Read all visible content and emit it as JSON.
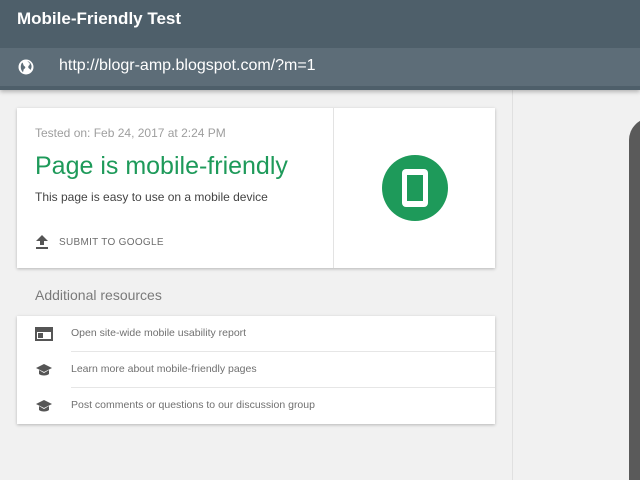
{
  "header": {
    "title": "Mobile-Friendly Test",
    "url": "http://blogr-amp.blogspot.com/?m=1",
    "globe_icon": "globe-icon"
  },
  "result": {
    "tested_on": "Tested on: Feb 24, 2017 at 2:24 PM",
    "verdict": "Page is mobile-friendly",
    "description": "This page is easy to use on a mobile device",
    "submit_label": "SUBMIT TO GOOGLE",
    "submit_icon": "upload-icon",
    "badge_icon": "phone-icon",
    "accent_color": "#1e9a5a"
  },
  "resources": {
    "title": "Additional resources",
    "items": [
      {
        "label": "Open site-wide mobile usability report",
        "icon": "browser-window-icon"
      },
      {
        "label": "Learn more about mobile-friendly pages",
        "icon": "graduation-cap-icon"
      },
      {
        "label": "Post comments or questions to our discussion group",
        "icon": "graduation-cap-icon"
      }
    ]
  }
}
